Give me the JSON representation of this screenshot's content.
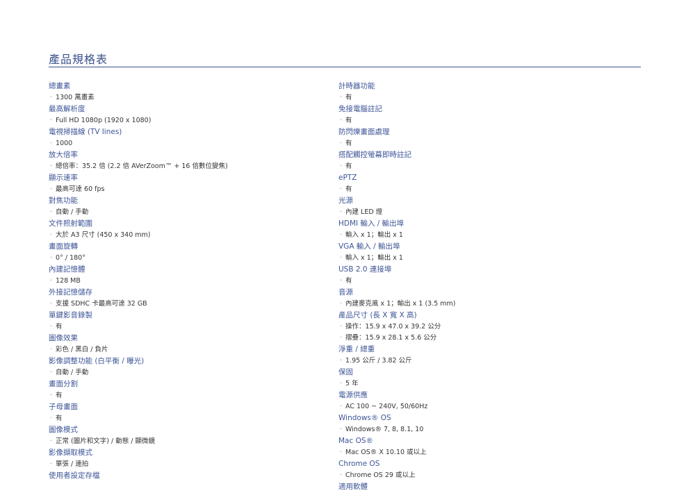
{
  "title": "產品規格表",
  "left": [
    {
      "head": "總畫素",
      "vals": [
        "1300 萬畫素"
      ]
    },
    {
      "head": "最高解析度",
      "vals": [
        "Full HD 1080p (1920 x 1080)"
      ]
    },
    {
      "head": "電視掃描線 (TV lines)",
      "vals": [
        "1000"
      ]
    },
    {
      "head": "放大倍率",
      "vals": [
        "總倍率：35.2 倍 (2.2 倍 AVerZoom™ + 16 倍數位變焦)"
      ]
    },
    {
      "head": "顯示速率",
      "vals": [
        "最高可達 60 fps"
      ]
    },
    {
      "head": "對焦功能",
      "vals": [
        "自動 / 手動"
      ]
    },
    {
      "head": "文件照射範圍",
      "vals": [
        "大於 A3 尺寸 (450 x 340 mm)"
      ]
    },
    {
      "head": "畫面旋轉",
      "vals": [
        "0° / 180°"
      ]
    },
    {
      "head": "內建記憶體",
      "vals": [
        "128 MB"
      ]
    },
    {
      "head": "外接記憶儲存",
      "vals": [
        "支援 SDHC 卡最高可達 32 GB"
      ]
    },
    {
      "head": "單鍵影音錄製",
      "vals": [
        "有"
      ]
    },
    {
      "head": "圖像效果",
      "vals": [
        "彩色 / 黑白 / 負片"
      ]
    },
    {
      "head": "影像調整功能 (白平衡 / 曝光)",
      "vals": [
        "自動 / 手動"
      ]
    },
    {
      "head": "畫面分割",
      "vals": [
        "有"
      ]
    },
    {
      "head": "子母畫面",
      "vals": [
        "有"
      ]
    },
    {
      "head": "圖像模式",
      "vals": [
        "正常 (圖片和文字) / 動態 / 顯微鏡"
      ]
    },
    {
      "head": "影像擷取模式",
      "vals": [
        "單張 / 連拍"
      ]
    },
    {
      "head": "使用者設定存檔",
      "vals": []
    }
  ],
  "right": [
    {
      "head": "計時器功能",
      "vals": [
        "有"
      ]
    },
    {
      "head": "免接電腦註記",
      "vals": [
        "有"
      ]
    },
    {
      "head": "防閃爍畫面處理",
      "vals": [
        "有"
      ]
    },
    {
      "head": "搭配觸控螢幕即時註記",
      "vals": [
        "有"
      ]
    },
    {
      "head": "ePTZ",
      "vals": [
        "有"
      ]
    },
    {
      "head": "光源",
      "vals": [
        "內建 LED 燈"
      ]
    },
    {
      "head": "HDMI 輸入 / 輸出埠",
      "vals": [
        "輸入 x 1；輸出 x 1"
      ]
    },
    {
      "head": "VGA 輸入 / 輸出埠",
      "vals": [
        "輸入 x 1；輸出 x 1"
      ]
    },
    {
      "head": "USB 2.0 連接埠",
      "vals": [
        "有"
      ]
    },
    {
      "head": "音源",
      "vals": [
        "內建麥克風 x 1；輸出 x 1 (3.5 mm)"
      ]
    },
    {
      "head": "產品尺寸 (長 X 寬 X 高)",
      "vals": [
        "操作：15.9 x 47.0 x 39.2 公分",
        "摺疊：15.9 x 28.1 x 5.6 公分"
      ]
    },
    {
      "head": "淨重 / 總重",
      "vals": [
        "1.95 公斤 / 3.82 公斤"
      ]
    },
    {
      "head": "保固",
      "vals": [
        "5 年"
      ]
    },
    {
      "head": "電源供應",
      "vals": [
        "AC 100 ~ 240V, 50/60Hz"
      ]
    },
    {
      "head": "Windows® OS",
      "vals": [
        "Windows® 7, 8, 8.1, 10"
      ]
    },
    {
      "head": "Mac OS®",
      "vals": [
        "Mac OS® X 10.10 或以上"
      ]
    },
    {
      "head": "Chrome OS",
      "vals": [
        "Chrome OS 29 或以上"
      ]
    },
    {
      "head": "適用軟體",
      "vals": []
    }
  ]
}
